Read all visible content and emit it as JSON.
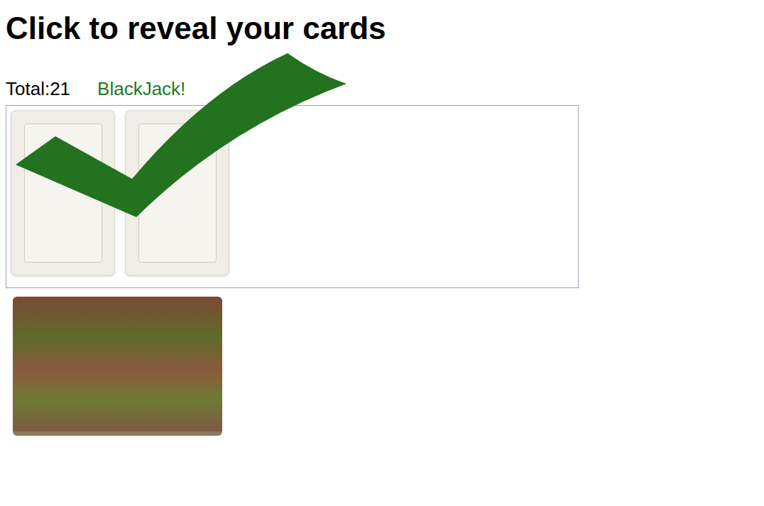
{
  "heading": "Click to reveal your cards",
  "total": "Total:21",
  "result": {
    "text": "BlackJack!",
    "win": true
  },
  "hand": [
    {
      "face_up": true
    },
    {
      "face_up": true
    }
  ],
  "deck": {
    "face_down": true
  }
}
